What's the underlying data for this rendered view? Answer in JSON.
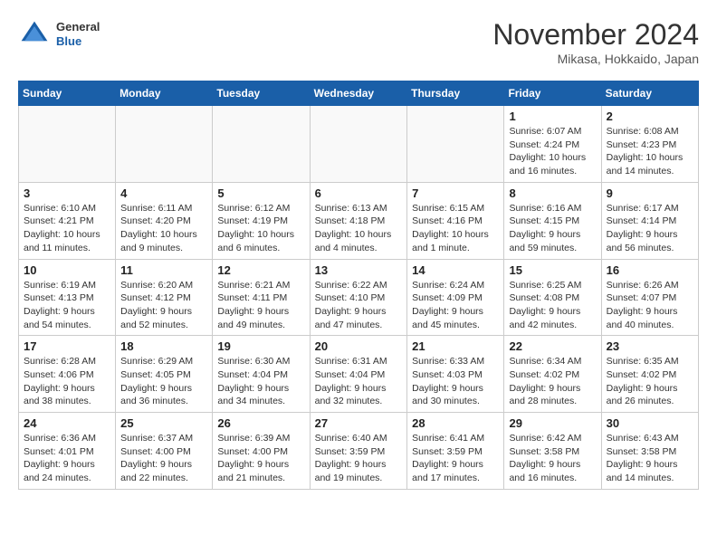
{
  "header": {
    "logo_general": "General",
    "logo_blue": "Blue",
    "month_title": "November 2024",
    "location": "Mikasa, Hokkaido, Japan"
  },
  "weekdays": [
    "Sunday",
    "Monday",
    "Tuesday",
    "Wednesday",
    "Thursday",
    "Friday",
    "Saturday"
  ],
  "weeks": [
    [
      {
        "day": "",
        "info": ""
      },
      {
        "day": "",
        "info": ""
      },
      {
        "day": "",
        "info": ""
      },
      {
        "day": "",
        "info": ""
      },
      {
        "day": "",
        "info": ""
      },
      {
        "day": "1",
        "info": "Sunrise: 6:07 AM\nSunset: 4:24 PM\nDaylight: 10 hours and 16 minutes."
      },
      {
        "day": "2",
        "info": "Sunrise: 6:08 AM\nSunset: 4:23 PM\nDaylight: 10 hours and 14 minutes."
      }
    ],
    [
      {
        "day": "3",
        "info": "Sunrise: 6:10 AM\nSunset: 4:21 PM\nDaylight: 10 hours and 11 minutes."
      },
      {
        "day": "4",
        "info": "Sunrise: 6:11 AM\nSunset: 4:20 PM\nDaylight: 10 hours and 9 minutes."
      },
      {
        "day": "5",
        "info": "Sunrise: 6:12 AM\nSunset: 4:19 PM\nDaylight: 10 hours and 6 minutes."
      },
      {
        "day": "6",
        "info": "Sunrise: 6:13 AM\nSunset: 4:18 PM\nDaylight: 10 hours and 4 minutes."
      },
      {
        "day": "7",
        "info": "Sunrise: 6:15 AM\nSunset: 4:16 PM\nDaylight: 10 hours and 1 minute."
      },
      {
        "day": "8",
        "info": "Sunrise: 6:16 AM\nSunset: 4:15 PM\nDaylight: 9 hours and 59 minutes."
      },
      {
        "day": "9",
        "info": "Sunrise: 6:17 AM\nSunset: 4:14 PM\nDaylight: 9 hours and 56 minutes."
      }
    ],
    [
      {
        "day": "10",
        "info": "Sunrise: 6:19 AM\nSunset: 4:13 PM\nDaylight: 9 hours and 54 minutes."
      },
      {
        "day": "11",
        "info": "Sunrise: 6:20 AM\nSunset: 4:12 PM\nDaylight: 9 hours and 52 minutes."
      },
      {
        "day": "12",
        "info": "Sunrise: 6:21 AM\nSunset: 4:11 PM\nDaylight: 9 hours and 49 minutes."
      },
      {
        "day": "13",
        "info": "Sunrise: 6:22 AM\nSunset: 4:10 PM\nDaylight: 9 hours and 47 minutes."
      },
      {
        "day": "14",
        "info": "Sunrise: 6:24 AM\nSunset: 4:09 PM\nDaylight: 9 hours and 45 minutes."
      },
      {
        "day": "15",
        "info": "Sunrise: 6:25 AM\nSunset: 4:08 PM\nDaylight: 9 hours and 42 minutes."
      },
      {
        "day": "16",
        "info": "Sunrise: 6:26 AM\nSunset: 4:07 PM\nDaylight: 9 hours and 40 minutes."
      }
    ],
    [
      {
        "day": "17",
        "info": "Sunrise: 6:28 AM\nSunset: 4:06 PM\nDaylight: 9 hours and 38 minutes."
      },
      {
        "day": "18",
        "info": "Sunrise: 6:29 AM\nSunset: 4:05 PM\nDaylight: 9 hours and 36 minutes."
      },
      {
        "day": "19",
        "info": "Sunrise: 6:30 AM\nSunset: 4:04 PM\nDaylight: 9 hours and 34 minutes."
      },
      {
        "day": "20",
        "info": "Sunrise: 6:31 AM\nSunset: 4:04 PM\nDaylight: 9 hours and 32 minutes."
      },
      {
        "day": "21",
        "info": "Sunrise: 6:33 AM\nSunset: 4:03 PM\nDaylight: 9 hours and 30 minutes."
      },
      {
        "day": "22",
        "info": "Sunrise: 6:34 AM\nSunset: 4:02 PM\nDaylight: 9 hours and 28 minutes."
      },
      {
        "day": "23",
        "info": "Sunrise: 6:35 AM\nSunset: 4:02 PM\nDaylight: 9 hours and 26 minutes."
      }
    ],
    [
      {
        "day": "24",
        "info": "Sunrise: 6:36 AM\nSunset: 4:01 PM\nDaylight: 9 hours and 24 minutes."
      },
      {
        "day": "25",
        "info": "Sunrise: 6:37 AM\nSunset: 4:00 PM\nDaylight: 9 hours and 22 minutes."
      },
      {
        "day": "26",
        "info": "Sunrise: 6:39 AM\nSunset: 4:00 PM\nDaylight: 9 hours and 21 minutes."
      },
      {
        "day": "27",
        "info": "Sunrise: 6:40 AM\nSunset: 3:59 PM\nDaylight: 9 hours and 19 minutes."
      },
      {
        "day": "28",
        "info": "Sunrise: 6:41 AM\nSunset: 3:59 PM\nDaylight: 9 hours and 17 minutes."
      },
      {
        "day": "29",
        "info": "Sunrise: 6:42 AM\nSunset: 3:58 PM\nDaylight: 9 hours and 16 minutes."
      },
      {
        "day": "30",
        "info": "Sunrise: 6:43 AM\nSunset: 3:58 PM\nDaylight: 9 hours and 14 minutes."
      }
    ]
  ]
}
